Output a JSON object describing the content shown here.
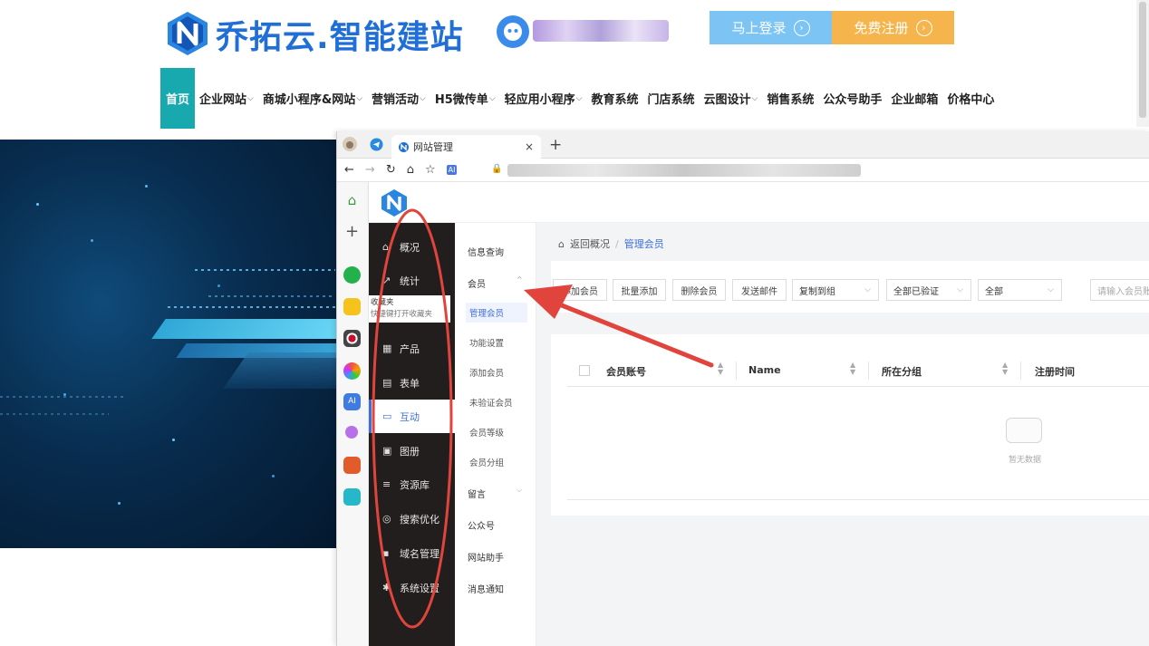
{
  "site": {
    "logo_text": "乔拓云.智能建站",
    "login_label": "马上登录",
    "register_label": "免费注册",
    "nav": [
      {
        "label": "首页",
        "caret": false
      },
      {
        "label": "企业网站",
        "caret": true
      },
      {
        "label": "商城小程序&网站",
        "caret": true
      },
      {
        "label": "营销活动",
        "caret": true
      },
      {
        "label": "H5微传单",
        "caret": true
      },
      {
        "label": "轻应用小程序",
        "caret": true
      },
      {
        "label": "教育系统",
        "caret": false
      },
      {
        "label": "门店系统",
        "caret": false
      },
      {
        "label": "云图设计",
        "caret": true
      },
      {
        "label": "销售系统",
        "caret": false
      },
      {
        "label": "公众号助手",
        "caret": false
      },
      {
        "label": "企业邮箱",
        "caret": false
      },
      {
        "label": "价格中心",
        "caret": false
      }
    ],
    "accent": "#17a9ad"
  },
  "browser": {
    "tab_title": "网站管理",
    "close_glyph": "×",
    "new_tab_glyph": "+",
    "ai_badge": "AI"
  },
  "app": {
    "sidebar": [
      {
        "label": "概况",
        "icon": "home-icon"
      },
      {
        "label": "统计",
        "icon": "chart-icon"
      },
      {
        "label": "产品",
        "icon": "grid-icon"
      },
      {
        "label": "表单",
        "icon": "form-icon"
      },
      {
        "label": "互动",
        "icon": "chat-icon",
        "active": true
      },
      {
        "label": "图册",
        "icon": "album-icon"
      },
      {
        "label": "资源库",
        "icon": "database-icon"
      },
      {
        "label": "搜索优化",
        "icon": "seo-icon"
      },
      {
        "label": "域名管理",
        "icon": "domain-icon"
      },
      {
        "label": "系统设置",
        "icon": "gear-icon"
      }
    ],
    "bookmark_popup": {
      "title": "收藏夹",
      "hint": "快捷键打开收藏夹"
    },
    "submenu": {
      "info": "信息查询",
      "member": "会员",
      "member_children": [
        "管理会员",
        "功能设置",
        "添加会员",
        "未验证会员",
        "会员等级",
        "会员分组"
      ],
      "message": "留言",
      "official": "公众号",
      "assistant": "网站助手",
      "notice": "消息通知"
    },
    "breadcrumb": {
      "back": "返回概况",
      "sep": "/",
      "current": "管理会员"
    },
    "toolbar": {
      "add": "添加会员",
      "batch_add": "批量添加",
      "delete": "删除会员",
      "send_mail": "发送邮件",
      "copy_to_group": "复制到组",
      "verify_filter": "全部已验证",
      "all_filter": "全部",
      "search_placeholder": "请输入会员账"
    },
    "table": {
      "columns": [
        "会员账号",
        "Name",
        "所在分组",
        "注册时间"
      ],
      "empty_text": "暂无数据"
    },
    "brand_color": "#3d6fd8"
  }
}
